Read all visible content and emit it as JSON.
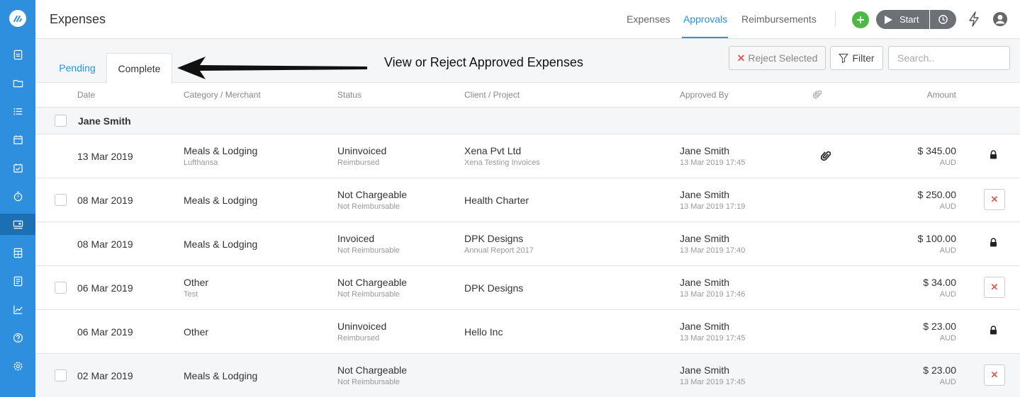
{
  "header": {
    "title": "Expenses",
    "nav": [
      "Expenses",
      "Approvals",
      "Reimbursements"
    ],
    "start_label": "Start"
  },
  "tabs": {
    "pending": "Pending",
    "complete": "Complete"
  },
  "annotation": "View or Reject Approved Expenses",
  "toolbar": {
    "reject_label": "Reject Selected",
    "filter_label": "Filter",
    "search_placeholder": "Search.."
  },
  "columns": {
    "date": "Date",
    "category": "Category / Merchant",
    "status": "Status",
    "client": "Client / Project",
    "approved_by": "Approved By",
    "amount": "Amount"
  },
  "group": {
    "name": "Jane Smith"
  },
  "rows": [
    {
      "date": "13 Mar 2019",
      "category": "Meals & Lodging",
      "merchant": "Lufthansa",
      "status": "Uninvoiced",
      "status_sub": "Reimbursed",
      "client": "Xena Pvt Ltd",
      "project": "Xena Testing Invoices",
      "approver": "Jane Smith",
      "approved_at": "13 Mar 2019 17:45",
      "amount": "$ 345.00",
      "currency": "AUD",
      "locked": true,
      "attachment": true
    },
    {
      "date": "08 Mar 2019",
      "category": "Meals & Lodging",
      "merchant": "",
      "status": "Not Chargeable",
      "status_sub": "Not Reimbursable",
      "client": "Health Charter",
      "project": "",
      "approver": "Jane Smith",
      "approved_at": "13 Mar 2019 17:19",
      "amount": "$ 250.00",
      "currency": "AUD",
      "locked": false,
      "attachment": false
    },
    {
      "date": "08 Mar 2019",
      "category": "Meals & Lodging",
      "merchant": "",
      "status": "Invoiced",
      "status_sub": "Not Reimbursable",
      "client": "DPK Designs",
      "project": "Annual Report 2017",
      "approver": "Jane Smith",
      "approved_at": "13 Mar 2019 17:40",
      "amount": "$ 100.00",
      "currency": "AUD",
      "locked": true,
      "attachment": false
    },
    {
      "date": "06 Mar 2019",
      "category": "Other",
      "merchant": "Test",
      "status": "Not Chargeable",
      "status_sub": "Not Reimbursable",
      "client": "DPK Designs",
      "project": "",
      "approver": "Jane Smith",
      "approved_at": "13 Mar 2019 17:46",
      "amount": "$ 34.00",
      "currency": "AUD",
      "locked": false,
      "attachment": false
    },
    {
      "date": "06 Mar 2019",
      "category": "Other",
      "merchant": "",
      "status": "Uninvoiced",
      "status_sub": "Reimbursed",
      "client": "Hello Inc",
      "project": "",
      "approver": "Jane Smith",
      "approved_at": "13 Mar 2019 17:45",
      "amount": "$ 23.00",
      "currency": "AUD",
      "locked": true,
      "attachment": false
    },
    {
      "date": "02 Mar 2019",
      "category": "Meals & Lodging",
      "merchant": "",
      "status": "Not Chargeable",
      "status_sub": "Not Reimbursable",
      "client": "",
      "project": "",
      "approver": "Jane Smith",
      "approved_at": "13 Mar 2019 17:45",
      "amount": "$ 23.00",
      "currency": "AUD",
      "locked": false,
      "attachment": false
    }
  ],
  "colors": {
    "accent": "#2e8fde",
    "sidebar": "#2e8fde",
    "add_green": "#4cb944",
    "reject_red": "#e05a5a"
  },
  "sidebar_icons": [
    "dashboard-icon",
    "folder-icon",
    "tasks-icon",
    "calendar-icon",
    "calendar-check-icon",
    "timer-icon",
    "expenses-icon",
    "calculator-icon",
    "invoice-icon",
    "reports-icon",
    "help-icon",
    "settings-icon"
  ]
}
